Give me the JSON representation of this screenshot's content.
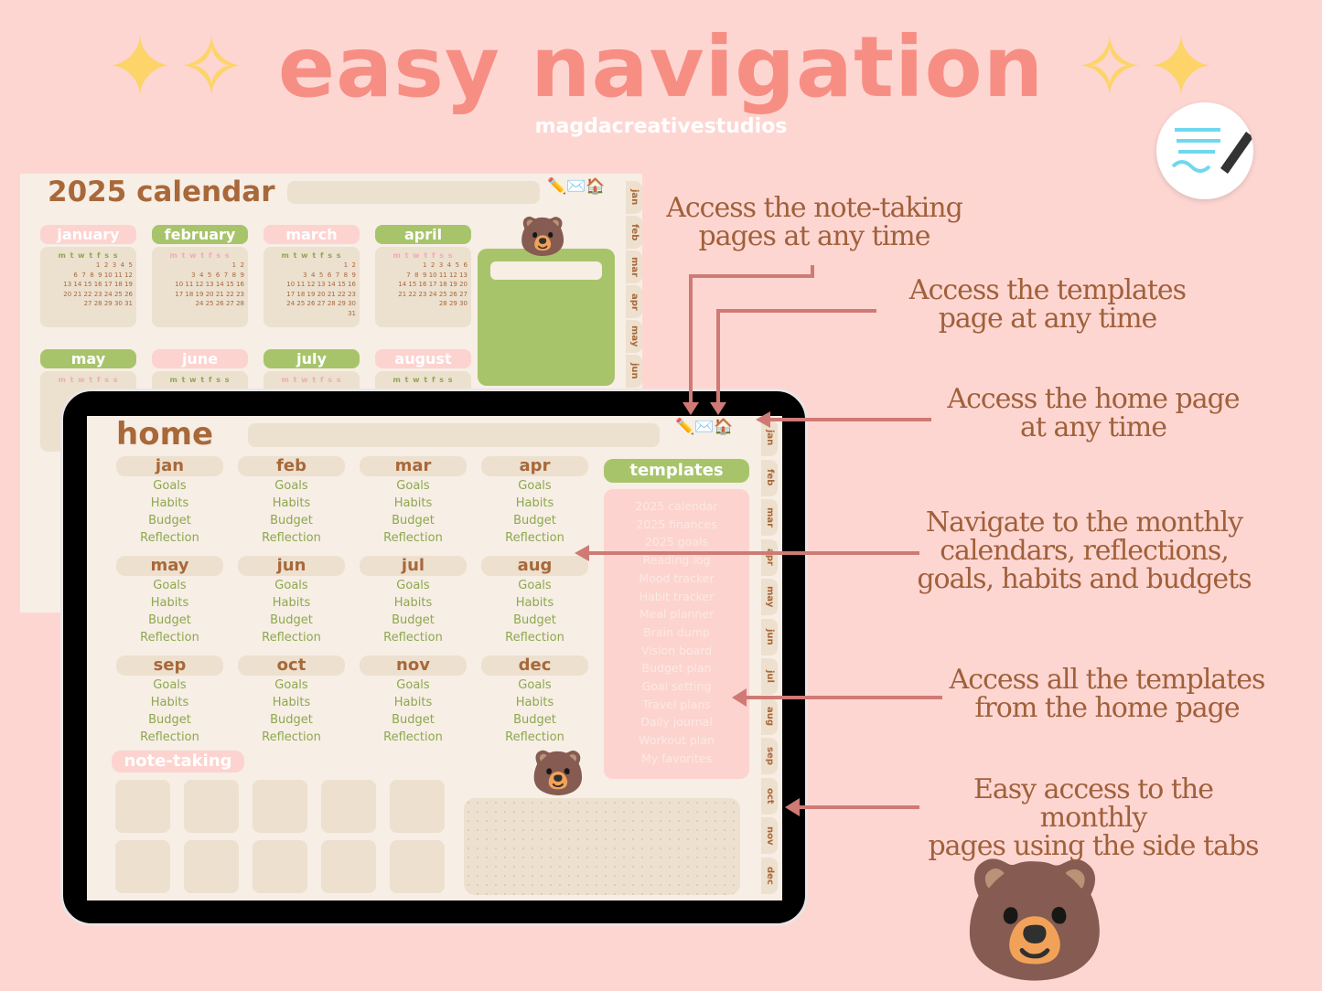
{
  "header": {
    "title": "easy navigation",
    "brand": "magdacreativestudios"
  },
  "calendar": {
    "title": "2025 calendar",
    "months": [
      "january",
      "february",
      "march",
      "april",
      "may",
      "june",
      "july",
      "august"
    ],
    "weekdays": "m t w t f s s",
    "grids": [
      "      1  2  3  4  5\n 6  7  8  9 10 11 12\n13 14 15 16 17 18 19\n20 21 22 23 24 25 26\n27 28 29 30 31",
      "                  1  2\n 3  4  5  6  7  8  9\n10 11 12 13 14 15 16\n17 18 19 20 21 22 23\n24 25 26 27 28",
      "                  1  2\n 3  4  5  6  7  8  9\n10 11 12 13 14 15 16\n17 18 19 20 21 22 23\n24 25 26 27 28 29 30\n31",
      "   1  2  3  4  5  6\n 7  8  9 10 11 12 13\n14 15 16 17 18 19 20\n21 22 23 24 25 26 27\n28 29 30"
    ],
    "tabs": [
      "jan",
      "feb",
      "mar",
      "apr",
      "may",
      "jun"
    ]
  },
  "home": {
    "title": "home",
    "months": [
      "jan",
      "feb",
      "mar",
      "apr",
      "may",
      "jun",
      "jul",
      "aug",
      "sep",
      "oct",
      "nov",
      "dec"
    ],
    "links": [
      "Goals",
      "Habits",
      "Budget",
      "Reflection"
    ],
    "templates_title": "templates",
    "templates": [
      "2025 calendar",
      "2025 finances",
      "2025 goals",
      "Reading log",
      "Mood tracker",
      "Habit tracker",
      "Meal planner",
      "Brain dump",
      "Vision board",
      "Budget plan",
      "Goal setting",
      "Travel plans",
      "Daily journal",
      "Workout plan",
      "My favorites"
    ],
    "note_taking": "note-taking",
    "tabs": [
      "jan",
      "feb",
      "mar",
      "apr",
      "may",
      "jun",
      "jul",
      "aug",
      "sep",
      "oct",
      "nov",
      "dec"
    ],
    "watermark": "magdacreativestudios"
  },
  "annotations": [
    "Access the note-taking\npages at any time",
    "Access the templates\npage at any time",
    "Access the home page\nat any time",
    "Navigate to the monthly\ncalendars, reflections,\ngoals, habits and budgets",
    "Access all the templates\nfrom the home page",
    "Easy access to the monthly\npages using the side tabs"
  ],
  "colors": {
    "background": "#fdd6d2",
    "title": "#f78e84",
    "green": "#a8c46b",
    "pink": "#fdd3cf",
    "brown": "#a8683a",
    "arrow": "#cf7a75"
  }
}
